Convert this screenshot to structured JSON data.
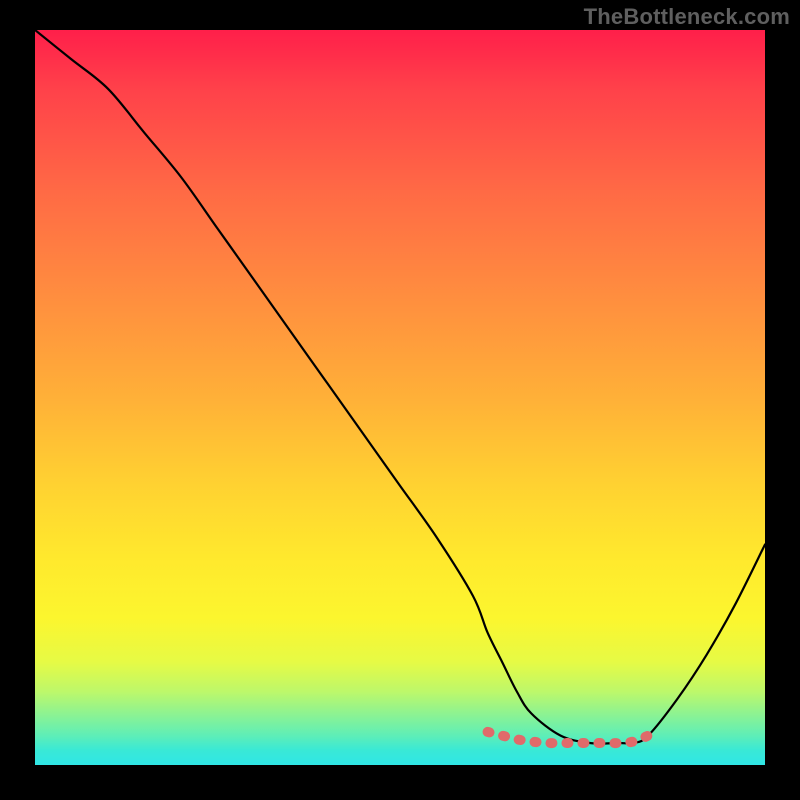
{
  "watermark": "TheBottleneck.com",
  "chart_data": {
    "type": "line",
    "title": "",
    "xlabel": "",
    "ylabel": "",
    "x_range": [
      0,
      100
    ],
    "y_range": [
      0,
      100
    ],
    "series": [
      {
        "name": "main-curve",
        "color": "#000000",
        "x": [
          0,
          5,
          10,
          15,
          20,
          25,
          30,
          35,
          40,
          45,
          50,
          55,
          60,
          62,
          64,
          66,
          68,
          72,
          76,
          80,
          82,
          84,
          88,
          92,
          96,
          100
        ],
        "y": [
          100,
          96,
          92,
          86,
          80,
          73,
          66,
          59,
          52,
          45,
          38,
          31,
          23,
          18,
          14,
          10,
          7,
          4,
          3,
          3,
          3,
          4,
          9,
          15,
          22,
          30
        ]
      },
      {
        "name": "highlight-band",
        "color": "#e57373",
        "x": [
          62,
          64,
          66,
          68,
          70,
          72,
          74,
          76,
          78,
          80,
          82,
          84
        ],
        "y": [
          4.5,
          4.0,
          3.5,
          3.2,
          3.0,
          3.0,
          3.0,
          3.0,
          3.0,
          3.0,
          3.2,
          4.0
        ]
      }
    ],
    "gradient_stops": [
      {
        "pos": 0,
        "color": "#ff1f4a"
      },
      {
        "pos": 50,
        "color": "#ffb038"
      },
      {
        "pos": 80,
        "color": "#fcf62e"
      },
      {
        "pos": 100,
        "color": "#30e6e6"
      }
    ]
  }
}
